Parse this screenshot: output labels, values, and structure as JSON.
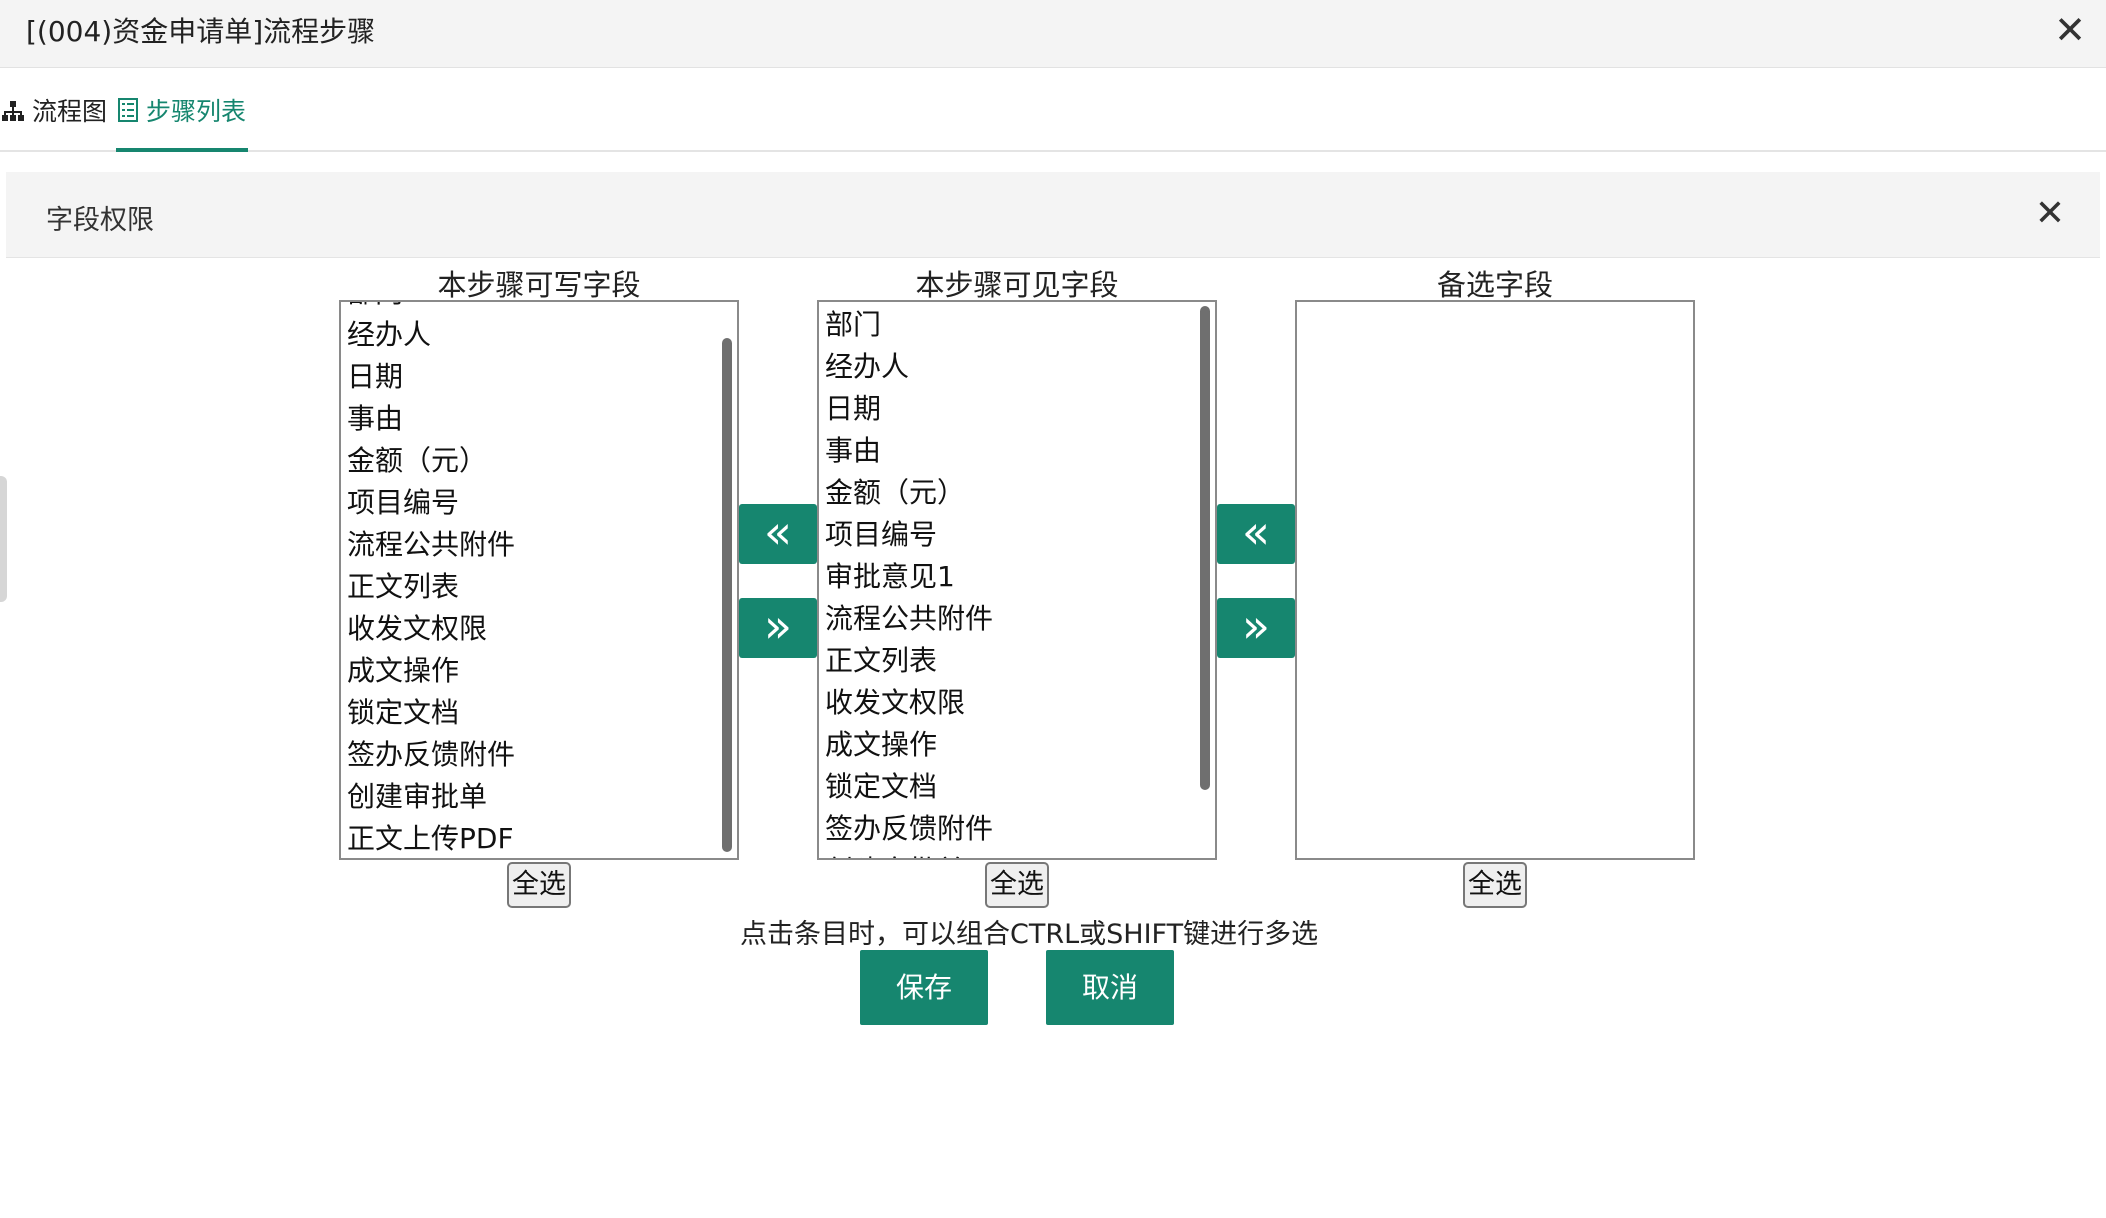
{
  "window": {
    "title": "[(004)资金申请单]流程步骤",
    "close_glyph": "✕"
  },
  "tabs": [
    {
      "label": "流程图",
      "icon": "sitemap-icon",
      "active": false
    },
    {
      "label": "步骤列表",
      "icon": "list-icon",
      "active": true
    }
  ],
  "dialog": {
    "title": "字段权限",
    "close_glyph": "✕"
  },
  "columns": {
    "writable": {
      "title": "本步骤可写字段",
      "items": [
        "部门",
        "经办人",
        "日期",
        "事由",
        "金额（元）",
        "项目编号",
        "流程公共附件",
        "正文列表",
        "收发文权限",
        "成文操作",
        "锁定文档",
        "签办反馈附件",
        "创建审批单",
        "正文上传PDF"
      ],
      "select_all_label": "全选"
    },
    "visible": {
      "title": "本步骤可见字段",
      "items": [
        "部门",
        "经办人",
        "日期",
        "事由",
        "金额（元）",
        "项目编号",
        "审批意见1",
        "流程公共附件",
        "正文列表",
        "收发文权限",
        "成文操作",
        "锁定文档",
        "签办反馈附件",
        "创建审批单"
      ],
      "select_all_label": "全选"
    },
    "candidate": {
      "title": "备选字段",
      "items": [],
      "select_all_label": "全选"
    }
  },
  "arrows": {
    "move_left": "«",
    "move_right": "»"
  },
  "hint": "点击条目时，可以组合CTRL或SHIFT键进行多选",
  "actions": {
    "save_label": "保存",
    "cancel_label": "取消"
  },
  "colors": {
    "accent": "#16866f",
    "header_bg": "#f4f4f4"
  }
}
